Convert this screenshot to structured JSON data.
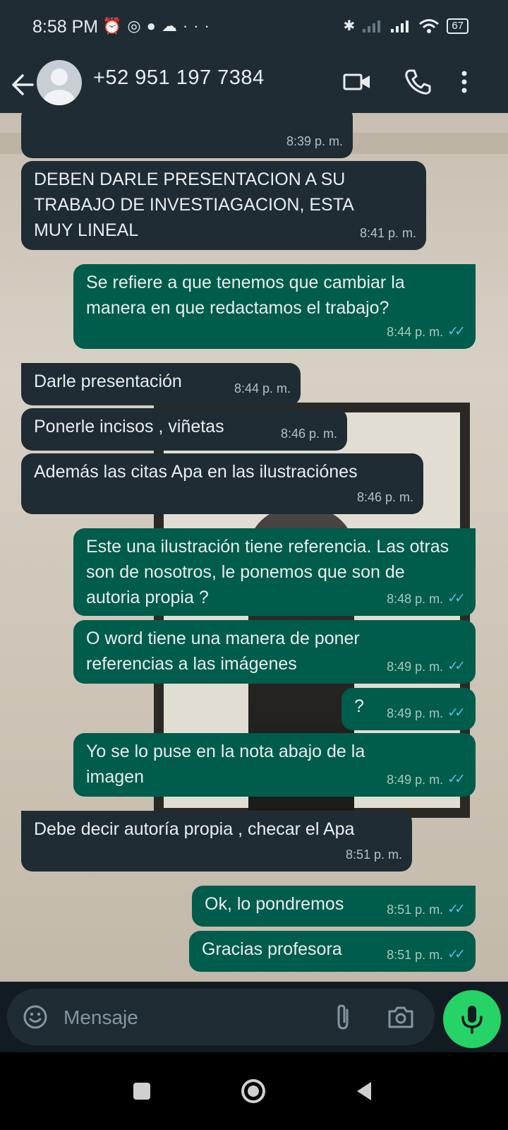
{
  "status_bar": {
    "time": "8:58 PM",
    "left_icons": [
      "alarm-icon",
      "instagram-icon",
      "reddit-icon",
      "cloud-icon",
      "more-icon"
    ],
    "dots": "···",
    "battery": "67",
    "right_icons": [
      "bluetooth-icon",
      "signal-icon",
      "signal-icon",
      "wifi-icon",
      "battery-icon"
    ]
  },
  "header": {
    "contact": "+52 951 197 7384",
    "icons": [
      "back-arrow-icon",
      "avatar",
      "video-call-icon",
      "phone-icon",
      "more-vert-icon"
    ]
  },
  "messages": [
    {
      "dir": "in",
      "text": "",
      "time": "8:39 p. m."
    },
    {
      "dir": "in",
      "text": "DEBEN DARLE PRESENTACION A SU TRABAJO DE INVESTIAGACION, ESTA MUY LINEAL",
      "time": "8:41 p. m."
    },
    {
      "dir": "out",
      "text": "Se refiere a que tenemos que cambiar la manera en que redactamos el trabajo?",
      "time": "8:44 p. m.",
      "ticks": "✓✓"
    },
    {
      "dir": "in",
      "text": "Darle presentación",
      "time": "8:44 p. m."
    },
    {
      "dir": "in",
      "text": "Ponerle incisos , viñetas",
      "time": "8:46 p. m."
    },
    {
      "dir": "in",
      "text": "Además las citas Apa en las ilustraciónes",
      "time": "8:46 p. m."
    },
    {
      "dir": "out",
      "text": "Este una ilustración tiene referencia. Las otras son de nosotros, le ponemos que son de autoria propia ?",
      "time": "8:48 p. m.",
      "ticks": "✓✓"
    },
    {
      "dir": "out",
      "text": "O word tiene una manera de poner referencias a las imágenes",
      "time": "8:49 p. m.",
      "ticks": "✓✓"
    },
    {
      "dir": "out",
      "text": "?",
      "time": "8:49 p. m.",
      "ticks": "✓✓"
    },
    {
      "dir": "out",
      "text": "Yo se lo puse en la nota abajo de la imagen",
      "time": "8:49 p. m.",
      "ticks": "✓✓"
    },
    {
      "dir": "in",
      "text": "Debe decir autoría propia , checar el Apa",
      "time": "8:51 p. m."
    },
    {
      "dir": "out",
      "text": "Ok, lo pondremos",
      "time": "8:51 p. m.",
      "ticks": "✓✓"
    },
    {
      "dir": "out",
      "text": "Gracias profesora",
      "time": "8:51 p. m.",
      "ticks": "✓✓"
    }
  ],
  "input": {
    "placeholder": "Mensaje",
    "icons": [
      "emoji-icon",
      "paperclip-icon",
      "camera-icon",
      "mic-icon"
    ]
  },
  "nav": {
    "icons": [
      "recents-icon",
      "home-icon",
      "back-icon"
    ]
  },
  "colors": {
    "header_bg": "#1f2c34",
    "incoming_bubble": "#1f2c34",
    "outgoing_bubble": "#005c4b",
    "read_ticks": "#53bdeb",
    "mic_button": "#25d366"
  }
}
